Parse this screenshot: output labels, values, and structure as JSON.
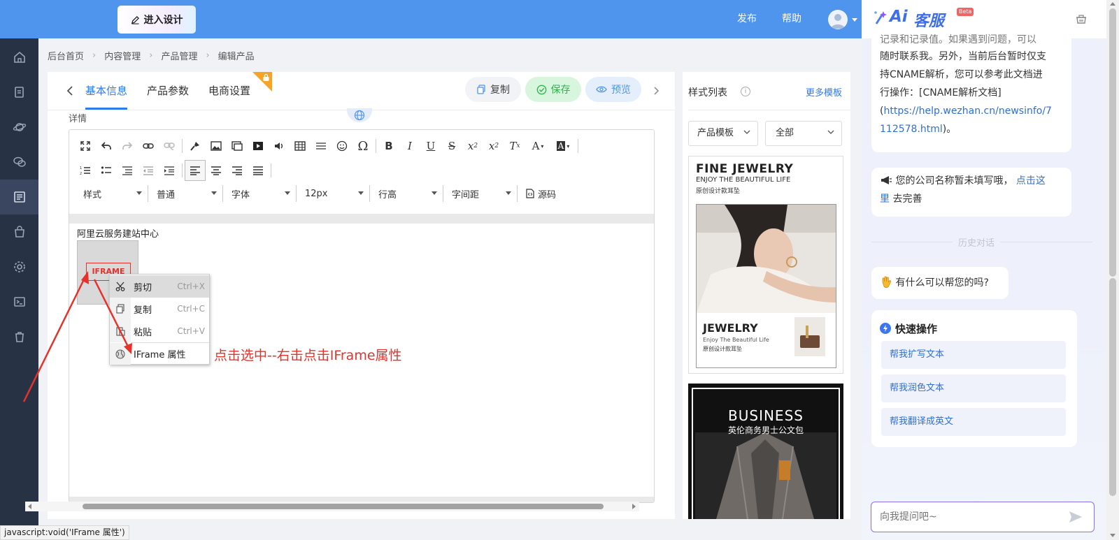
{
  "topbar": {
    "design_button": "进入设计",
    "publish": "发布",
    "help": "帮助"
  },
  "sidebar": {
    "items": [
      "home-icon",
      "pages-icon",
      "planet-icon",
      "chat-icon",
      "list-icon",
      "bag-icon",
      "gear-icon",
      "terminal-icon",
      "trash-icon"
    ]
  },
  "breadcrumb": [
    "后台首页",
    "内容管理",
    "产品管理",
    "编辑产品"
  ],
  "tabs": [
    "基本信息",
    "产品参数",
    "电商设置"
  ],
  "actions": {
    "copy": "复制",
    "save": "保存",
    "preview": "预览"
  },
  "editor": {
    "field_label": "详情",
    "selects": [
      "样式",
      "普通",
      "字体",
      "12px",
      "行高",
      "字间距"
    ],
    "source_label": "源码",
    "content_text": "阿里云服务建站中心",
    "iframe_placeholder": "IFRAME"
  },
  "context_menu": [
    {
      "label": "剪切",
      "shortcut": "Ctrl+X"
    },
    {
      "label": "复制",
      "shortcut": "Ctrl+C"
    },
    {
      "label": "粘贴",
      "shortcut": "Ctrl+V"
    },
    {
      "label": "IFrame 属性",
      "shortcut": ""
    }
  ],
  "annotation": "点击选中--右击点击IFrame属性",
  "style_panel": {
    "title": "样式列表",
    "more": "更多模板",
    "filter_type": "产品模板",
    "filter_all": "全部",
    "card1": {
      "title": "FINE JEWELRY",
      "subtitle": "ENJOY THE BEAUTIFUL LIFE",
      "line3": "原创设计款耳坠",
      "bottom_title": "JEWELRY",
      "bottom_sub": "Enjoy The Beautiful Life",
      "bottom_cn": "原创设计款耳坠"
    },
    "card2": {
      "title": "BUSINESS",
      "subtitle": "英伦商务男士公文包"
    }
  },
  "ai_panel": {
    "brand_ai": "Ai",
    "brand_name": "客服",
    "beta": "Beta",
    "msg1_top": "记录和记录值。如果遇到问题，可以",
    "msg1_lines": [
      "随时联系我。另外，当前后台暂时仅支",
      "持CNAME解析，您可以参考此文档进",
      "行操作：[CNAME解析文档]"
    ],
    "msg1_link_open": "(",
    "msg1_link": "https://help.wezhan.cn/newsinfo/7112578.html",
    "msg1_link_line1": "https://help.wezhan.cn/newsinfo/7",
    "msg1_link_line2": "112578.html",
    "msg1_link_close": ")。",
    "msg2_text": "您的公司名称暂未填写哦，",
    "msg2_link": "点击这里",
    "msg2_link_a": "点击这",
    "msg2_link_b": "里",
    "msg2_tail": "去完善",
    "history": "历史对话",
    "greeting": "有什么可以帮您的吗?",
    "quick_title": "快速操作",
    "quick": [
      "帮我扩写文本",
      "帮我润色文本",
      "帮我翻译成英文"
    ],
    "input_placeholder": "向我提问吧~"
  },
  "status_bar": "javascript:void('IFrame 属性')",
  "colors": {
    "primary": "#4f95ee",
    "sidebar": "#283245",
    "accent_red": "#e5322b",
    "save_green": "#30b34a"
  }
}
